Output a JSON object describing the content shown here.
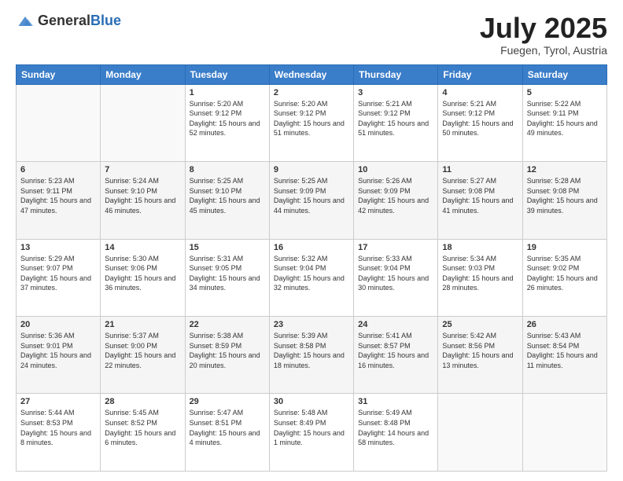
{
  "logo": {
    "general": "General",
    "blue": "Blue"
  },
  "header": {
    "month_year": "July 2025",
    "location": "Fuegen, Tyrol, Austria"
  },
  "weekdays": [
    "Sunday",
    "Monday",
    "Tuesday",
    "Wednesday",
    "Thursday",
    "Friday",
    "Saturday"
  ],
  "weeks": [
    [
      {
        "day": "",
        "sunrise": "",
        "sunset": "",
        "daylight": ""
      },
      {
        "day": "",
        "sunrise": "",
        "sunset": "",
        "daylight": ""
      },
      {
        "day": "1",
        "sunrise": "Sunrise: 5:20 AM",
        "sunset": "Sunset: 9:12 PM",
        "daylight": "Daylight: 15 hours and 52 minutes."
      },
      {
        "day": "2",
        "sunrise": "Sunrise: 5:20 AM",
        "sunset": "Sunset: 9:12 PM",
        "daylight": "Daylight: 15 hours and 51 minutes."
      },
      {
        "day": "3",
        "sunrise": "Sunrise: 5:21 AM",
        "sunset": "Sunset: 9:12 PM",
        "daylight": "Daylight: 15 hours and 51 minutes."
      },
      {
        "day": "4",
        "sunrise": "Sunrise: 5:21 AM",
        "sunset": "Sunset: 9:12 PM",
        "daylight": "Daylight: 15 hours and 50 minutes."
      },
      {
        "day": "5",
        "sunrise": "Sunrise: 5:22 AM",
        "sunset": "Sunset: 9:11 PM",
        "daylight": "Daylight: 15 hours and 49 minutes."
      }
    ],
    [
      {
        "day": "6",
        "sunrise": "Sunrise: 5:23 AM",
        "sunset": "Sunset: 9:11 PM",
        "daylight": "Daylight: 15 hours and 47 minutes."
      },
      {
        "day": "7",
        "sunrise": "Sunrise: 5:24 AM",
        "sunset": "Sunset: 9:10 PM",
        "daylight": "Daylight: 15 hours and 46 minutes."
      },
      {
        "day": "8",
        "sunrise": "Sunrise: 5:25 AM",
        "sunset": "Sunset: 9:10 PM",
        "daylight": "Daylight: 15 hours and 45 minutes."
      },
      {
        "day": "9",
        "sunrise": "Sunrise: 5:25 AM",
        "sunset": "Sunset: 9:09 PM",
        "daylight": "Daylight: 15 hours and 44 minutes."
      },
      {
        "day": "10",
        "sunrise": "Sunrise: 5:26 AM",
        "sunset": "Sunset: 9:09 PM",
        "daylight": "Daylight: 15 hours and 42 minutes."
      },
      {
        "day": "11",
        "sunrise": "Sunrise: 5:27 AM",
        "sunset": "Sunset: 9:08 PM",
        "daylight": "Daylight: 15 hours and 41 minutes."
      },
      {
        "day": "12",
        "sunrise": "Sunrise: 5:28 AM",
        "sunset": "Sunset: 9:08 PM",
        "daylight": "Daylight: 15 hours and 39 minutes."
      }
    ],
    [
      {
        "day": "13",
        "sunrise": "Sunrise: 5:29 AM",
        "sunset": "Sunset: 9:07 PM",
        "daylight": "Daylight: 15 hours and 37 minutes."
      },
      {
        "day": "14",
        "sunrise": "Sunrise: 5:30 AM",
        "sunset": "Sunset: 9:06 PM",
        "daylight": "Daylight: 15 hours and 36 minutes."
      },
      {
        "day": "15",
        "sunrise": "Sunrise: 5:31 AM",
        "sunset": "Sunset: 9:05 PM",
        "daylight": "Daylight: 15 hours and 34 minutes."
      },
      {
        "day": "16",
        "sunrise": "Sunrise: 5:32 AM",
        "sunset": "Sunset: 9:04 PM",
        "daylight": "Daylight: 15 hours and 32 minutes."
      },
      {
        "day": "17",
        "sunrise": "Sunrise: 5:33 AM",
        "sunset": "Sunset: 9:04 PM",
        "daylight": "Daylight: 15 hours and 30 minutes."
      },
      {
        "day": "18",
        "sunrise": "Sunrise: 5:34 AM",
        "sunset": "Sunset: 9:03 PM",
        "daylight": "Daylight: 15 hours and 28 minutes."
      },
      {
        "day": "19",
        "sunrise": "Sunrise: 5:35 AM",
        "sunset": "Sunset: 9:02 PM",
        "daylight": "Daylight: 15 hours and 26 minutes."
      }
    ],
    [
      {
        "day": "20",
        "sunrise": "Sunrise: 5:36 AM",
        "sunset": "Sunset: 9:01 PM",
        "daylight": "Daylight: 15 hours and 24 minutes."
      },
      {
        "day": "21",
        "sunrise": "Sunrise: 5:37 AM",
        "sunset": "Sunset: 9:00 PM",
        "daylight": "Daylight: 15 hours and 22 minutes."
      },
      {
        "day": "22",
        "sunrise": "Sunrise: 5:38 AM",
        "sunset": "Sunset: 8:59 PM",
        "daylight": "Daylight: 15 hours and 20 minutes."
      },
      {
        "day": "23",
        "sunrise": "Sunrise: 5:39 AM",
        "sunset": "Sunset: 8:58 PM",
        "daylight": "Daylight: 15 hours and 18 minutes."
      },
      {
        "day": "24",
        "sunrise": "Sunrise: 5:41 AM",
        "sunset": "Sunset: 8:57 PM",
        "daylight": "Daylight: 15 hours and 16 minutes."
      },
      {
        "day": "25",
        "sunrise": "Sunrise: 5:42 AM",
        "sunset": "Sunset: 8:56 PM",
        "daylight": "Daylight: 15 hours and 13 minutes."
      },
      {
        "day": "26",
        "sunrise": "Sunrise: 5:43 AM",
        "sunset": "Sunset: 8:54 PM",
        "daylight": "Daylight: 15 hours and 11 minutes."
      }
    ],
    [
      {
        "day": "27",
        "sunrise": "Sunrise: 5:44 AM",
        "sunset": "Sunset: 8:53 PM",
        "daylight": "Daylight: 15 hours and 8 minutes."
      },
      {
        "day": "28",
        "sunrise": "Sunrise: 5:45 AM",
        "sunset": "Sunset: 8:52 PM",
        "daylight": "Daylight: 15 hours and 6 minutes."
      },
      {
        "day": "29",
        "sunrise": "Sunrise: 5:47 AM",
        "sunset": "Sunset: 8:51 PM",
        "daylight": "Daylight: 15 hours and 4 minutes."
      },
      {
        "day": "30",
        "sunrise": "Sunrise: 5:48 AM",
        "sunset": "Sunset: 8:49 PM",
        "daylight": "Daylight: 15 hours and 1 minute."
      },
      {
        "day": "31",
        "sunrise": "Sunrise: 5:49 AM",
        "sunset": "Sunset: 8:48 PM",
        "daylight": "Daylight: 14 hours and 58 minutes."
      },
      {
        "day": "",
        "sunrise": "",
        "sunset": "",
        "daylight": ""
      },
      {
        "day": "",
        "sunrise": "",
        "sunset": "",
        "daylight": ""
      }
    ]
  ]
}
